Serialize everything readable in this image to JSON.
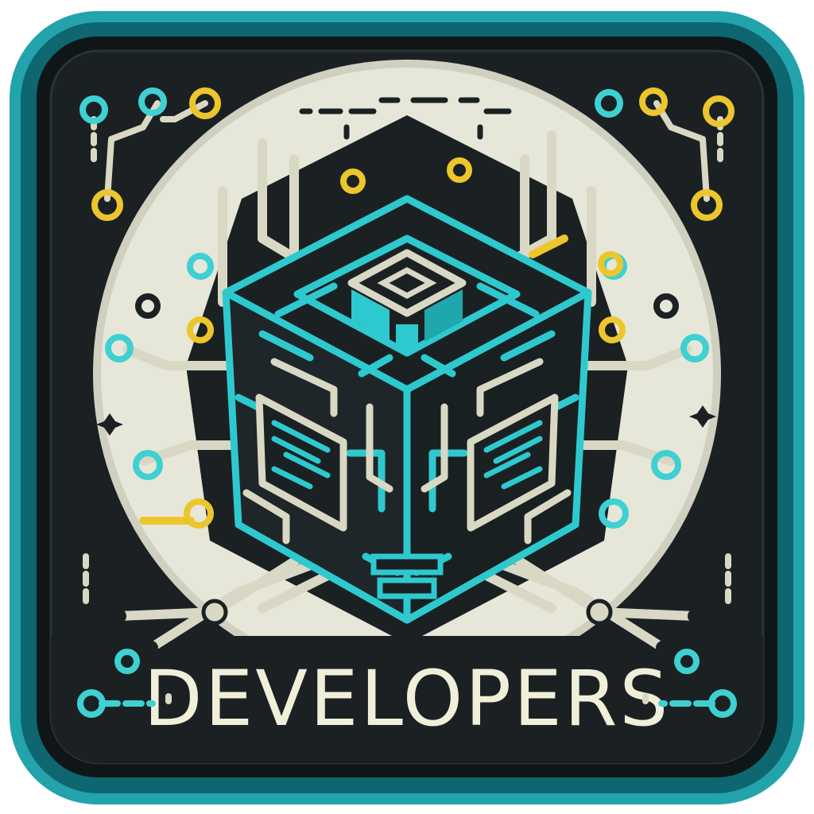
{
  "badge": {
    "title": "DEVELOPERS",
    "icon": "circuit-cube-icon"
  },
  "colors": {
    "frame_outer": "#1f8f98",
    "frame_inner": "#0b6872",
    "background": "#141a1c",
    "panel": "#1e2426",
    "glow_circle": "#e4e5d6",
    "cube_outline": "#2ec9cf",
    "trace_cream": "#d8d8c4",
    "accent_yellow": "#ecc62c",
    "accent_cyan": "#3fd0d2",
    "title": "#f0efd9"
  }
}
